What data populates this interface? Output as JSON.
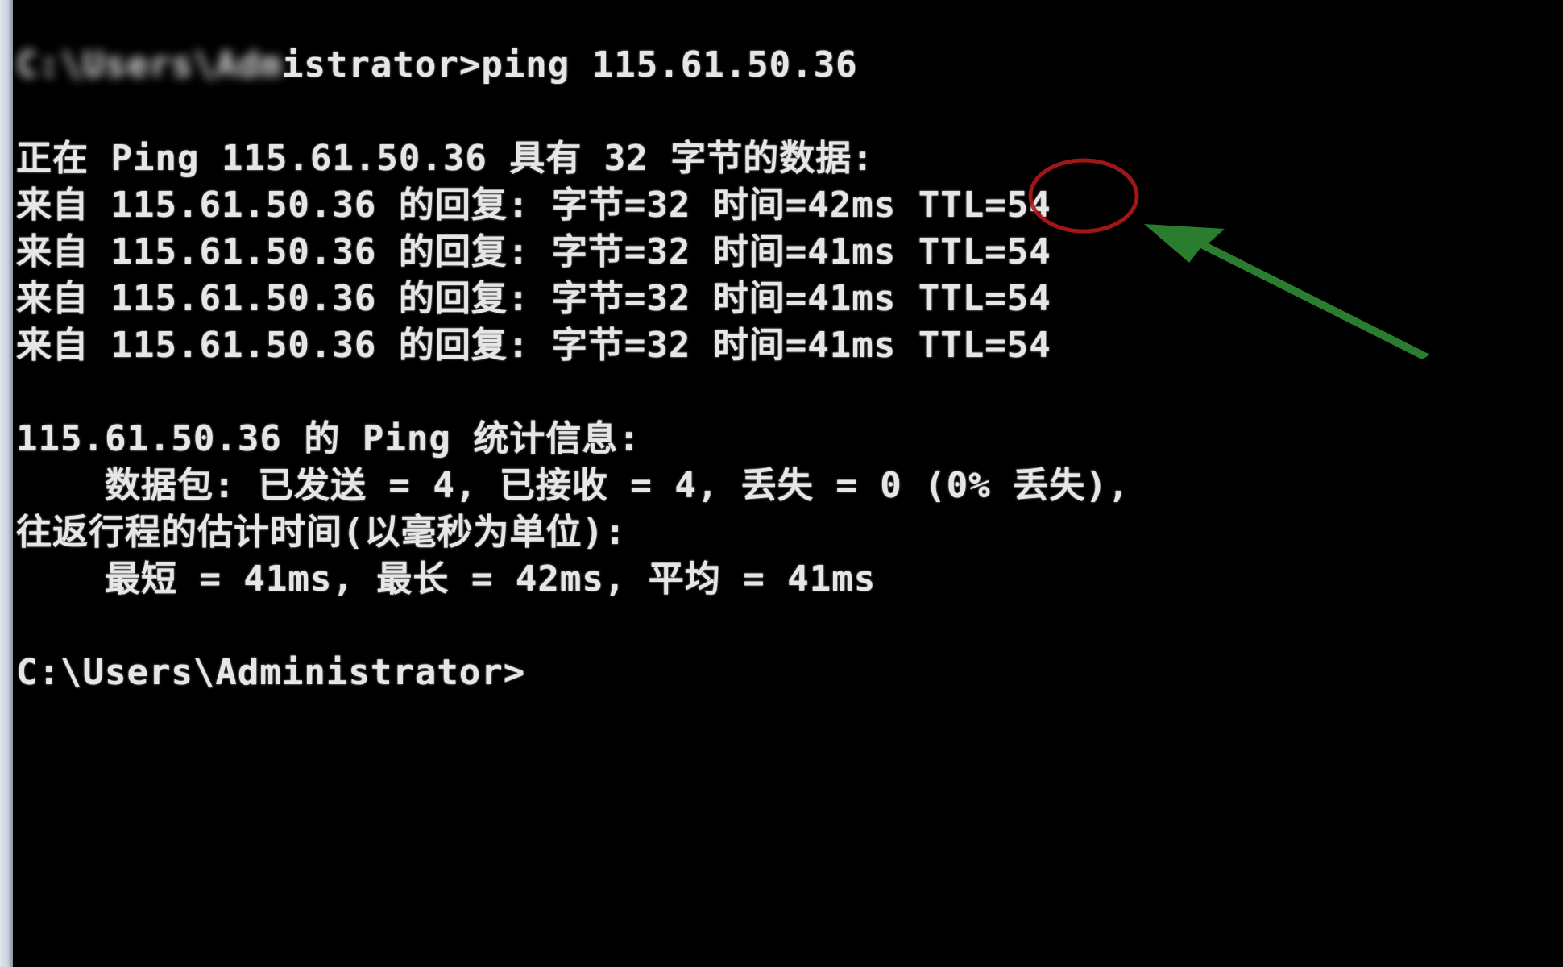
{
  "console": {
    "cmd_prefix_blurred": "C:\\Users\\Adm",
    "cmd_line_visible": "istrator>ping 115.61.50.36",
    "lines": [
      "正在 Ping 115.61.50.36 具有 32 字节的数据:",
      "来自 115.61.50.36 的回复: 字节=32 时间=42ms TTL=54",
      "来自 115.61.50.36 的回复: 字节=32 时间=41ms TTL=54",
      "来自 115.61.50.36 的回复: 字节=32 时间=41ms TTL=54",
      "来自 115.61.50.36 的回复: 字节=32 时间=41ms TTL=54",
      "115.61.50.36 的 Ping 统计信息:",
      "    数据包: 已发送 = 4, 已接收 = 4, 丢失 = 0 (0% 丢失),",
      "往返行程的估计时间(以毫秒为单位):",
      "    最短 = 41ms, 最长 = 42ms, 平均 = 41ms",
      "C:\\Users\\Administrator>"
    ]
  },
  "annotation": {
    "circle_color": "#b01818",
    "arrow_color": "#2f8a34"
  }
}
